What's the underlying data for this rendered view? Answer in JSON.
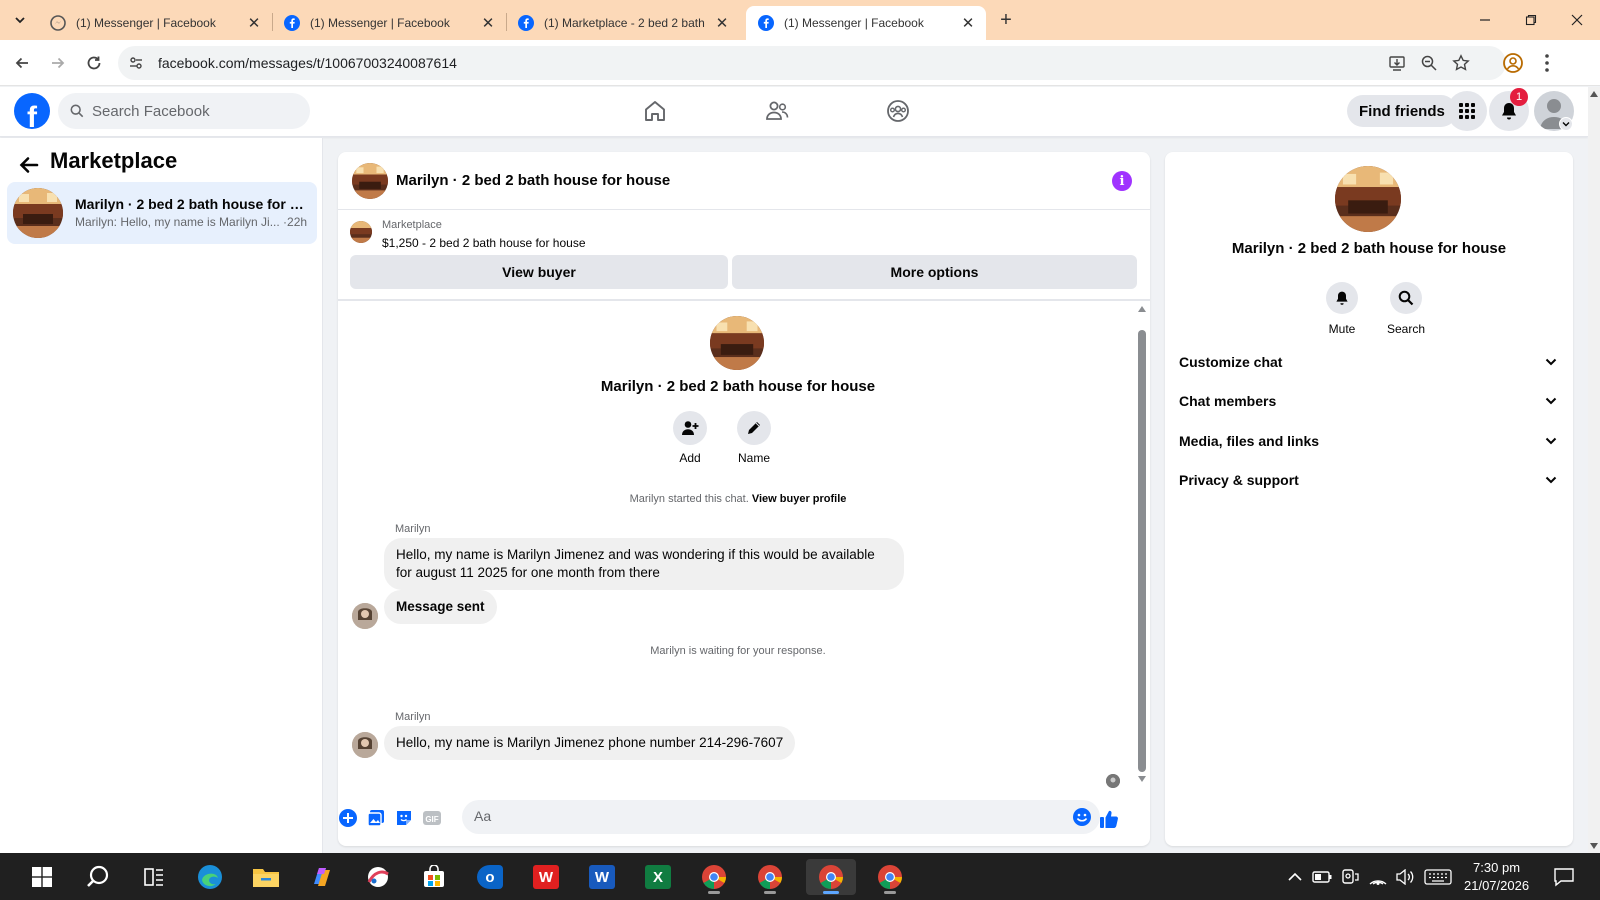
{
  "browser": {
    "tabs": [
      {
        "title": "(1) Messenger | Facebook",
        "favicon": "messenger-icon"
      },
      {
        "title": "(1) Messenger | Facebook",
        "favicon": "facebook-icon"
      },
      {
        "title": "(1) Marketplace - 2 bed 2 bath",
        "favicon": "facebook-icon"
      },
      {
        "title": "(1) Messenger | Facebook",
        "favicon": "facebook-icon",
        "active": true
      }
    ],
    "url": "facebook.com/messages/t/10067003240087614",
    "tab_bar_color": "#fcd9b8"
  },
  "fb_header": {
    "logo": "f",
    "search_placeholder": "Search Facebook",
    "find_friends_label": "Find friends",
    "notification_count": "1",
    "brand_color": "#0866ff"
  },
  "left_panel": {
    "title": "Marketplace",
    "conversations": [
      {
        "title": "Marilyn · 2 bed 2 bath house for h...",
        "snippet": "Marilyn: Hello, my name is Marilyn Ji... ·22h"
      }
    ]
  },
  "chat": {
    "header_name": "Marilyn · 2 bed 2 bath house for house",
    "listing_label": "Marketplace",
    "listing_price": "$1,250 - 2 bed 2 bath house for house",
    "view_buyer_label": "View buyer",
    "more_options_label": "More options",
    "intro_name": "Marilyn · 2 bed 2 bath house for house",
    "add_label": "Add",
    "name_label": "Name",
    "started_text": "Marilyn started this chat.",
    "view_profile_link": "View buyer profile",
    "messages": [
      {
        "sender": "Marilyn",
        "text": "Hello, my name is Marilyn Jimenez and was wondering if this would be available for august 11 2025 for one month from there"
      },
      {
        "text": "Message sent"
      },
      {
        "sender": "Marilyn",
        "text": "Hello, my name is Marilyn Jimenez phone number 214-296-7607"
      }
    ],
    "waiting_text": "Marilyn is waiting for your response.",
    "composer_placeholder": "Aa",
    "accent_color": "#0866ff",
    "info_color": "#a033ff"
  },
  "right_panel": {
    "name": "Marilyn · 2 bed 2 bath house for house",
    "mute_label": "Mute",
    "search_label": "Search",
    "sections": [
      "Customize chat",
      "Chat members",
      "Media, files and links",
      "Privacy & support"
    ]
  },
  "taskbar": {
    "time": "7:30 pm",
    "date": "21/07/2026"
  }
}
